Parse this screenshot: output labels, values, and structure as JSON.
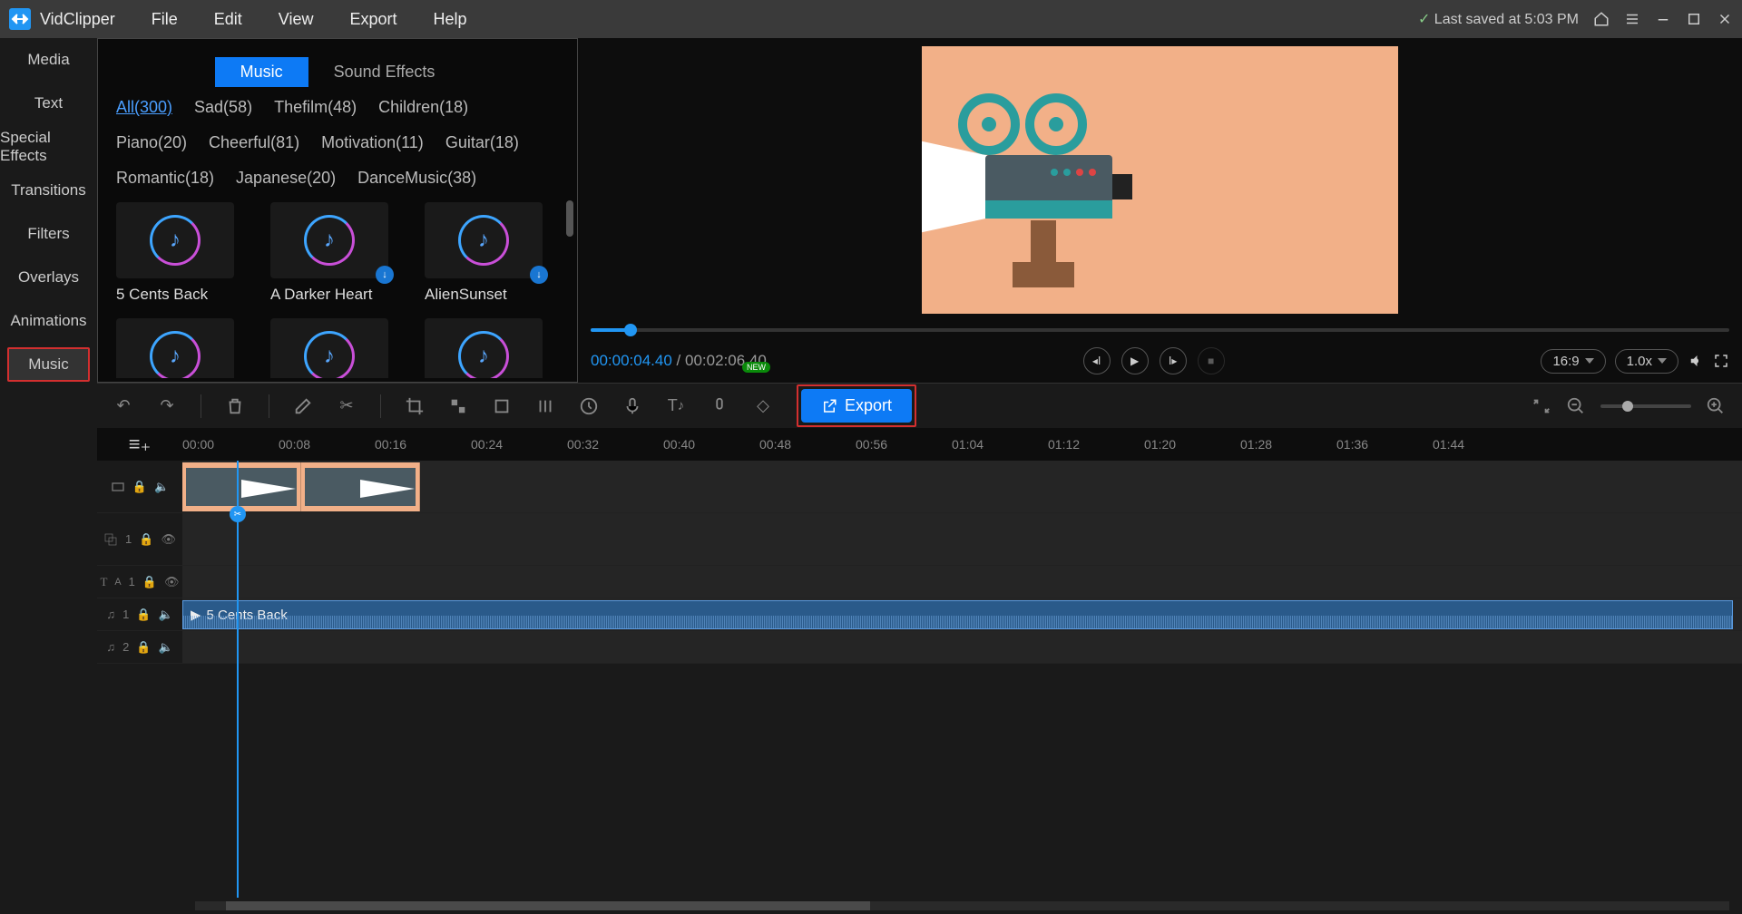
{
  "app": {
    "name": "VidClipper"
  },
  "menubar": [
    "File",
    "Edit",
    "View",
    "Export",
    "Help"
  ],
  "last_saved": "Last saved at 5:03 PM",
  "sidebar": {
    "items": [
      "Media",
      "Text",
      "Special Effects",
      "Transitions",
      "Filters",
      "Overlays",
      "Animations",
      "Music"
    ],
    "active_index": 7
  },
  "media_panel": {
    "tabs": [
      "Music",
      "Sound Effects"
    ],
    "active_tab": 0,
    "categories": [
      {
        "label": "All(300)",
        "active": true
      },
      {
        "label": "Sad(58)"
      },
      {
        "label": "Thefilm(48)"
      },
      {
        "label": "Children(18)"
      },
      {
        "label": "Piano(20)"
      },
      {
        "label": "Cheerful(81)"
      },
      {
        "label": "Motivation(11)"
      },
      {
        "label": "Guitar(18)"
      },
      {
        "label": "Romantic(18)"
      },
      {
        "label": "Japanese(20)"
      },
      {
        "label": "DanceMusic(38)"
      }
    ],
    "thumbs": [
      {
        "label": "5 Cents Back",
        "downloadable": false
      },
      {
        "label": "A Darker Heart",
        "downloadable": true
      },
      {
        "label": "AlienSunset",
        "downloadable": true
      },
      {
        "label": "",
        "downloadable": true
      },
      {
        "label": "",
        "downloadable": true
      },
      {
        "label": "",
        "downloadable": true
      }
    ]
  },
  "preview": {
    "current_time": "00:00:04.40",
    "total_time": "00:02:06.40",
    "aspect": "16:9",
    "speed": "1.0x"
  },
  "toolbar": {
    "export_label": "Export",
    "new_badge": "NEW"
  },
  "timeline": {
    "ticks": [
      "00:00",
      "00:08",
      "00:16",
      "00:24",
      "00:32",
      "00:40",
      "00:48",
      "00:56",
      "01:04",
      "01:12",
      "01:20",
      "01:28",
      "01:36",
      "01:44"
    ],
    "audio_clip_label": "5 Cents Back",
    "overlay_track_label": "1",
    "text_track_label": "1",
    "audio_track_labels": [
      "1",
      "2"
    ]
  }
}
